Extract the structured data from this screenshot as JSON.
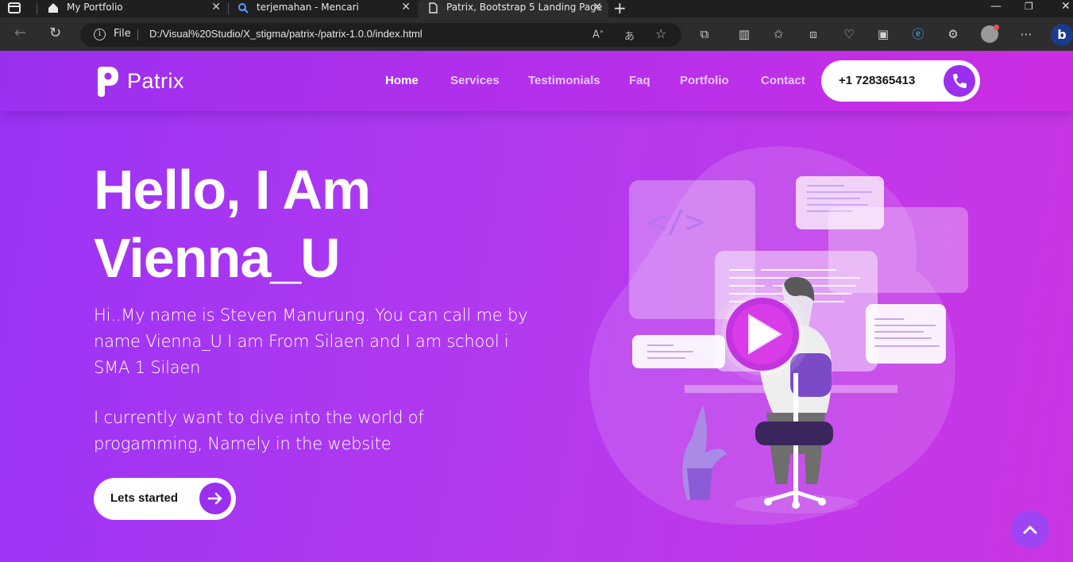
{
  "browser": {
    "tabs": [
      {
        "title": "My Portfolio",
        "icon": "home-icon"
      },
      {
        "title": "terjemahan - Mencari",
        "icon": "search-icon"
      },
      {
        "title": "Patrix, Bootstrap 5 Landing Page",
        "icon": "page-icon"
      }
    ],
    "address": {
      "scheme_label": "File",
      "url": "D:/Visual%20Studio/X_stigma/patrix-/patrix-1.0.0/index.html"
    }
  },
  "site": {
    "brand": "Patrix",
    "nav": [
      {
        "label": "Home",
        "active": true
      },
      {
        "label": "Services",
        "active": false
      },
      {
        "label": "Testimonials",
        "active": false
      },
      {
        "label": "Faq",
        "active": false
      },
      {
        "label": "Portfolio",
        "active": false
      },
      {
        "label": "Contact",
        "active": false
      }
    ],
    "phone": "+1 728365413",
    "accent": "#9a2fee"
  },
  "hero": {
    "title_line1": "Hello, I Am",
    "title_line2": "Vienna_U",
    "paragraph1": "Hi..My name is Steven Manurung. You can call me by name Vienna_U I am From Silaen and I am school i SMA 1 Silaen",
    "paragraph2": "I currently want to dive into the world of progamming, Namely in the website",
    "cta_label": "Lets started",
    "illustration_code_label": "</>"
  }
}
